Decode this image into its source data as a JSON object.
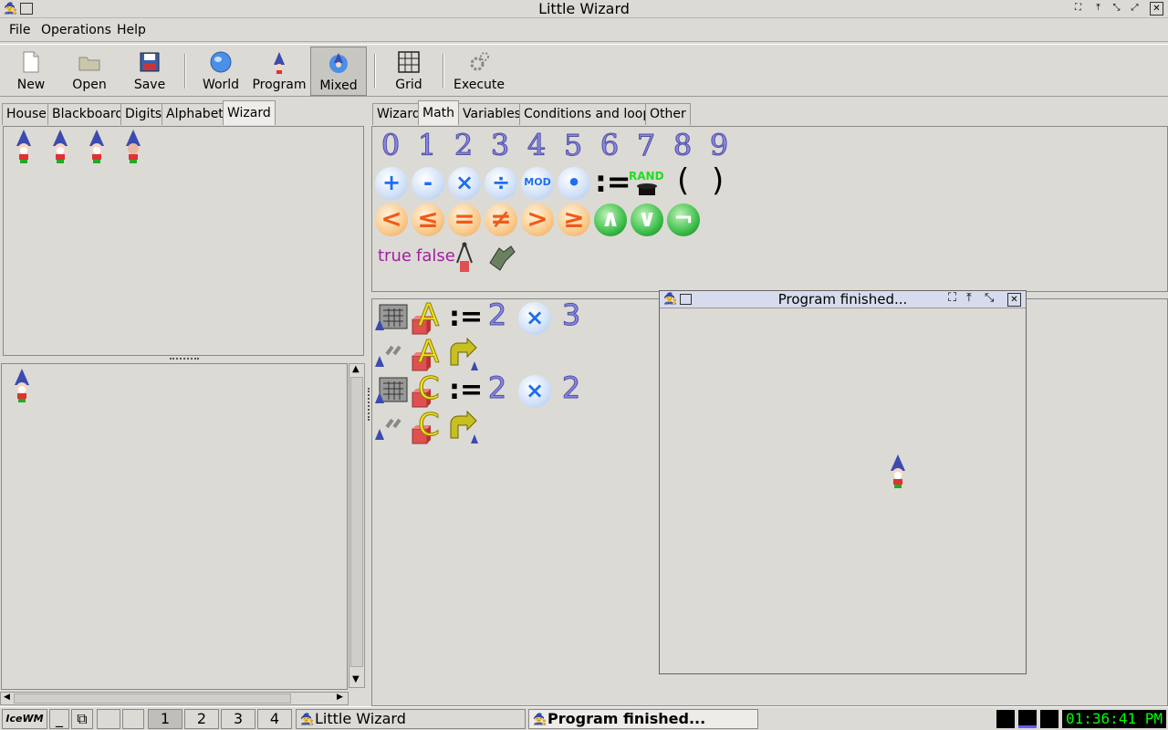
{
  "window": {
    "title": "Little Wizard"
  },
  "menu": [
    "File",
    "Operations",
    "Help"
  ],
  "toolbar": {
    "new": "New",
    "open": "Open",
    "save": "Save",
    "world": "World",
    "program": "Program",
    "mixed": "Mixed",
    "grid": "Grid",
    "execute": "Execute"
  },
  "left_tabs": [
    "House",
    "Blackboard",
    "Digits",
    "Alphabet",
    "Wizard"
  ],
  "right_tabs": [
    "Wizard",
    "Math",
    "Variables",
    "Conditions and loops",
    "Other"
  ],
  "palette": {
    "digits": [
      "0",
      "1",
      "2",
      "3",
      "4",
      "5",
      "6",
      "7",
      "8",
      "9"
    ],
    "ops": [
      "+",
      "-",
      "×",
      "÷",
      "MOD",
      "•"
    ],
    "assign": ":=",
    "rand": "RAND",
    "lparen": "(",
    "rparen": ")",
    "compare": [
      "<",
      "≤",
      "=",
      "≠",
      ">",
      "≥"
    ],
    "logic": [
      "∧",
      "∨",
      "¬"
    ],
    "true": "true",
    "false": "false"
  },
  "program": {
    "lines": [
      {
        "var": "A",
        "assign": ":=",
        "left": "2",
        "op": "×",
        "right": "3"
      },
      {
        "var": "A"
      },
      {
        "var": "C",
        "assign": ":=",
        "left": "2",
        "op": "×",
        "right": "2"
      },
      {
        "var": "C"
      }
    ]
  },
  "popup": {
    "title": "Program finished..."
  },
  "taskbar": {
    "workspaces": [
      "1",
      "2",
      "3",
      "4"
    ],
    "task1": "Little Wizard",
    "task2": "Program finished...",
    "clock": "01:36:41 PM"
  },
  "colors": {
    "accent": "#8888e8",
    "clock": "#00ff00",
    "popup_header": "#d6dced"
  }
}
